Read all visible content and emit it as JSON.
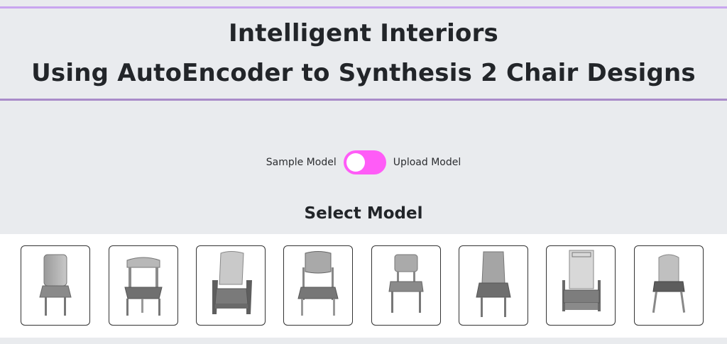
{
  "header": {
    "title_line1": "Intelligent Interiors",
    "title_line2": "Using AutoEncoder to Synthesis 2 Chair Designs",
    "accent_top": "#c9a6ef",
    "accent_bottom": "#a98bc9"
  },
  "mode_toggle": {
    "left_label": "Sample Model",
    "right_label": "Upload Model",
    "state": "sample",
    "color": "#ff5cf7"
  },
  "gallery": {
    "title": "Select Model",
    "items": [
      {
        "icon": "chair-1-icon"
      },
      {
        "icon": "chair-2-icon"
      },
      {
        "icon": "chair-3-icon"
      },
      {
        "icon": "chair-4-icon"
      },
      {
        "icon": "chair-5-icon"
      },
      {
        "icon": "chair-6-icon"
      },
      {
        "icon": "chair-7-icon"
      },
      {
        "icon": "chair-8-icon"
      }
    ]
  }
}
